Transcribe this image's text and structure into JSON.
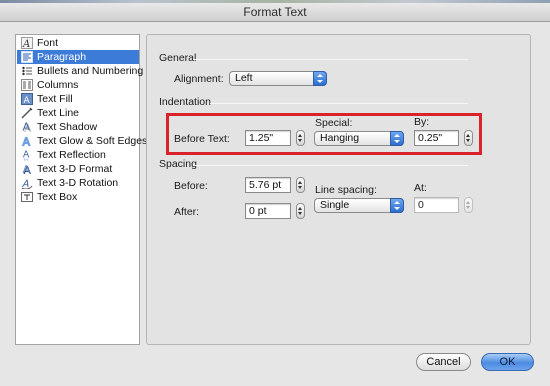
{
  "window": {
    "title": "Format Text"
  },
  "sidebar": {
    "items": [
      {
        "label": "Font",
        "icon": "font-icon"
      },
      {
        "label": "Paragraph",
        "icon": "paragraph-icon",
        "selected": true
      },
      {
        "label": "Bullets and Numbering",
        "icon": "bullets-icon"
      },
      {
        "label": "Columns",
        "icon": "columns-icon"
      },
      {
        "label": "Text Fill",
        "icon": "text-fill-icon"
      },
      {
        "label": "Text Line",
        "icon": "text-line-icon"
      },
      {
        "label": "Text Shadow",
        "icon": "text-shadow-icon"
      },
      {
        "label": "Text Glow & Soft Edges",
        "icon": "text-glow-icon"
      },
      {
        "label": "Text Reflection",
        "icon": "text-reflection-icon"
      },
      {
        "label": "Text 3-D Format",
        "icon": "text-3d-format-icon"
      },
      {
        "label": "Text 3-D Rotation",
        "icon": "text-3d-rotation-icon"
      },
      {
        "label": "Text Box",
        "icon": "text-box-icon"
      }
    ]
  },
  "general": {
    "heading": "General",
    "alignment_label": "Alignment:",
    "alignment_value": "Left"
  },
  "indentation": {
    "heading": "Indentation",
    "before_text_label": "Before Text:",
    "before_text_value": "1.25\"",
    "special_label": "Special:",
    "special_value": "Hanging",
    "by_label": "By:",
    "by_value": "0.25\""
  },
  "spacing": {
    "heading": "Spacing",
    "before_label": "Before:",
    "before_value": "5.76 pt",
    "after_label": "After:",
    "after_value": "0 pt",
    "line_spacing_label": "Line spacing:",
    "line_spacing_value": "Single",
    "at_label": "At:",
    "at_value": "0"
  },
  "buttons": {
    "cancel": "Cancel",
    "ok": "OK"
  },
  "colors": {
    "selection": "#3d7bd8",
    "highlight_box": "#d9222a",
    "popup_arrow": "#2c6fd1",
    "ok_button": "#4c8be1"
  }
}
